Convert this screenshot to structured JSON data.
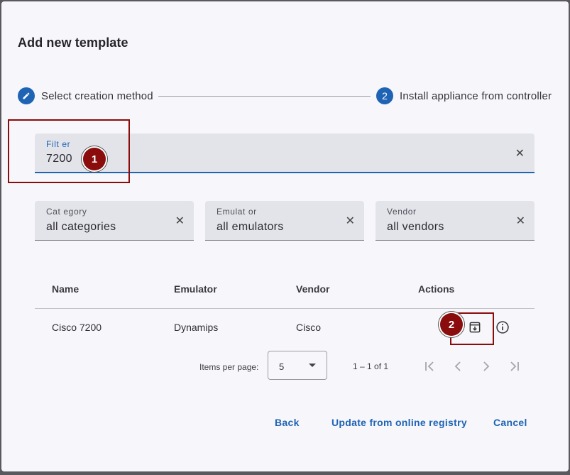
{
  "dialog": {
    "title": "Add new template"
  },
  "stepper": {
    "steps": [
      {
        "number": "1",
        "icon": "pencil-icon",
        "label": "Select creation method"
      },
      {
        "number": "2",
        "label": "Install appliance from controller"
      }
    ]
  },
  "filter": {
    "label": "Filt er",
    "value": "7200",
    "clear_icon": "close-icon"
  },
  "selects": {
    "category": {
      "label": "Cat egory",
      "value": "all categories"
    },
    "emulator": {
      "label": "Emulat or",
      "value": "all emulators"
    },
    "vendor": {
      "label": "Vendor",
      "value": "all vendors"
    }
  },
  "table": {
    "headers": [
      "Name",
      "Emulator",
      "Vendor",
      "Actions"
    ],
    "rows": [
      {
        "name": "Cisco 7200",
        "emulator": "Dynamips",
        "vendor": "Cisco",
        "actions": [
          "install-icon",
          "info-icon"
        ]
      }
    ]
  },
  "paginator": {
    "items_per_page_label": "Items per page:",
    "page_size": "5",
    "range_label": "1 – 1 of 1"
  },
  "footer": {
    "back": "Back",
    "update": "Update from online registry",
    "cancel": "Cancel"
  },
  "annotations": {
    "callout_1": "1",
    "callout_2": "2",
    "color": "#8a0c0c"
  },
  "colors": {
    "accent": "#1e63b4",
    "field_bg": "#e3e4ea",
    "dialog_bg": "#f7f7fb"
  }
}
